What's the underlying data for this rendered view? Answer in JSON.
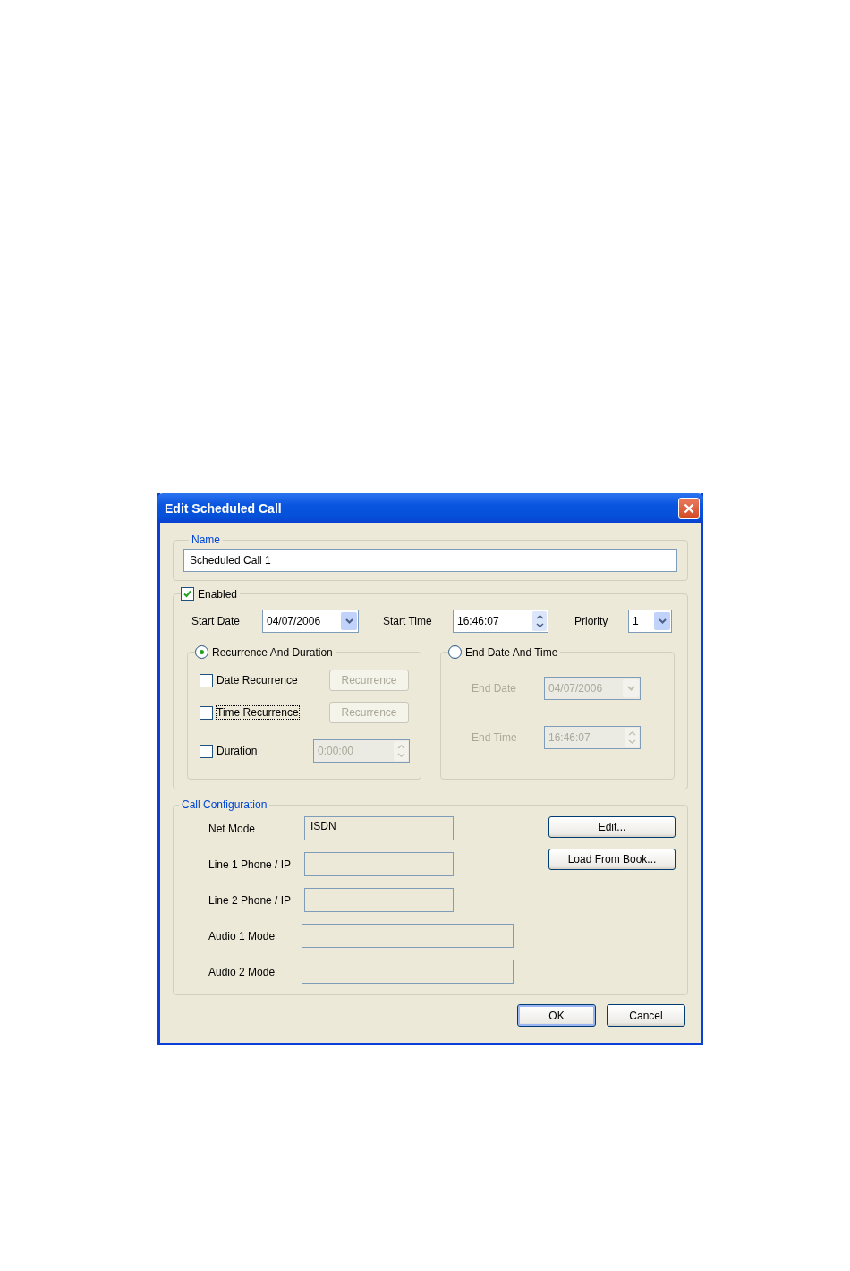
{
  "window": {
    "title": "Edit Scheduled Call"
  },
  "name_group": {
    "label": "Name",
    "value": "Scheduled Call 1"
  },
  "schedule": {
    "enabled": {
      "label": "Enabled",
      "checked": true
    },
    "start_date": {
      "label": "Start Date",
      "value": "04/07/2006"
    },
    "start_time": {
      "label": "Start Time",
      "value": "16:46:07"
    },
    "priority": {
      "label": "Priority",
      "value": "1"
    },
    "modes": [
      {
        "label": "Recurrence And Duration",
        "selected": true
      },
      {
        "label": "End Date And Time",
        "selected": false
      }
    ],
    "recurrence_rows": [
      {
        "kind": "button",
        "label": "Date Recurrence",
        "checked": false,
        "focused": false,
        "control": "Recurrence",
        "disabled": true
      },
      {
        "kind": "button",
        "label": "Time Recurrence",
        "checked": false,
        "focused": true,
        "control": "Recurrence",
        "disabled": true
      },
      {
        "kind": "spinner",
        "label": "Duration",
        "checked": false,
        "focused": false,
        "control": "0:00:00",
        "disabled": true
      }
    ],
    "end_rows": [
      {
        "kind": "dropdown",
        "label": "End Date",
        "value": "04/07/2006",
        "disabled": true
      },
      {
        "kind": "spinner",
        "label": "End Time",
        "value": "16:46:07",
        "disabled": true
      }
    ]
  },
  "call_configuration": {
    "label": "Call Configuration",
    "fields": [
      {
        "label": "Net Mode",
        "value": "ISDN",
        "kind": "short"
      },
      {
        "label": "Line 1 Phone / IP",
        "kind": "short"
      },
      {
        "label": "Line 2 Phone / IP",
        "kind": "short"
      },
      {
        "label": "Audio 1 Mode",
        "kind": "wide"
      },
      {
        "label": "Audio 2 Mode",
        "kind": "wide"
      }
    ],
    "buttons": [
      "Edit...",
      "Load From Book..."
    ]
  },
  "buttons": [
    {
      "label": "OK",
      "default": true
    },
    {
      "label": "Cancel",
      "default": false
    }
  ]
}
